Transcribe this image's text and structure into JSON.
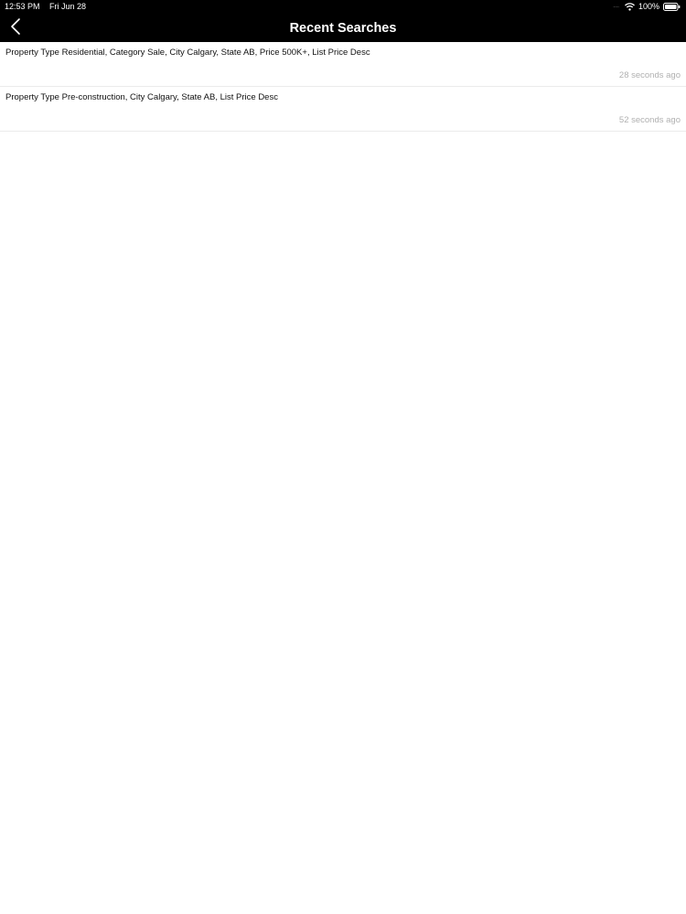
{
  "status_bar": {
    "time": "12:53 PM",
    "date": "Fri Jun 28",
    "signal": "....",
    "battery": "100%"
  },
  "header": {
    "title": "Recent Searches",
    "back_icon": "chevron-left-icon"
  },
  "recent_searches": [
    {
      "query": "Property Type Residential, Category Sale, City Calgary, State AB, Price 500K+, List Price Desc",
      "time": "28 seconds ago"
    },
    {
      "query": "Property Type Pre-construction, City Calgary, State AB, List Price Desc",
      "time": "52 seconds ago"
    }
  ],
  "colors": {
    "bar_background": "#000000",
    "bar_text": "#ffffff",
    "row_text": "#111111",
    "timestamp_text": "#b0b0b0",
    "divider": "#ebebeb"
  }
}
